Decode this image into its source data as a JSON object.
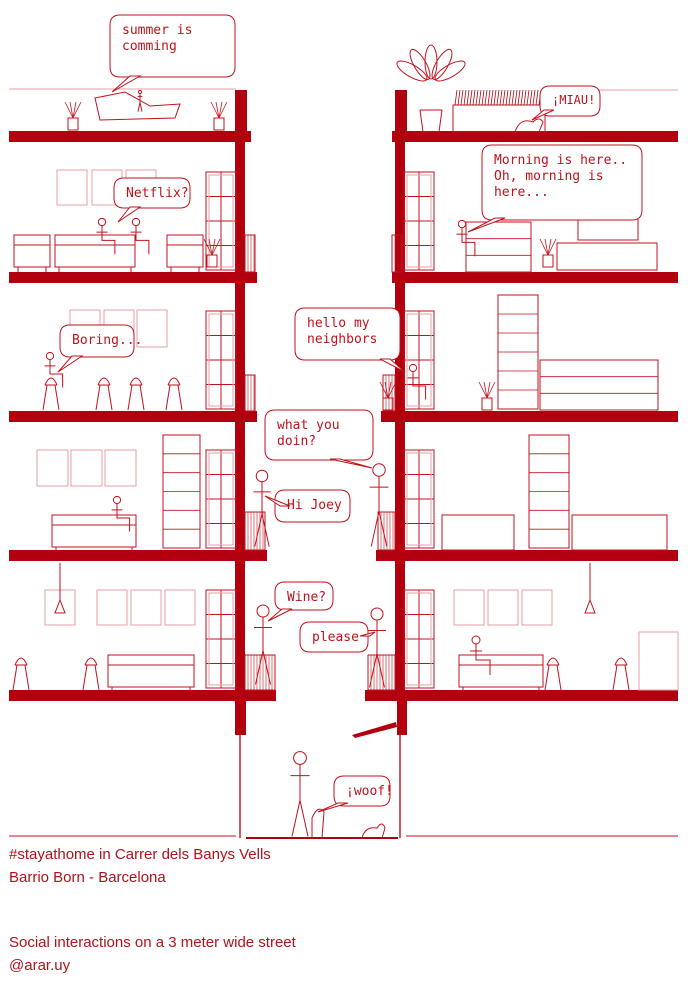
{
  "colors": {
    "accent": "#b3000f",
    "line": "#c0121c",
    "light_line": "#e6a1a6"
  },
  "bubbles": {
    "summer": "summer is\ncomming",
    "miau": "¡MIAU!",
    "netflix": "Netflix?",
    "morning": "Morning is here..\nOh, morning is\nhere...",
    "boring": "Boring...",
    "hello": "hello my\nneighbors",
    "what": "what you\ndoin?",
    "hijoey": "Hi Joey",
    "wine": "Wine?",
    "please": "please",
    "woof": "¡woof!"
  },
  "caption": {
    "line1": "#stayathome in Carrer dels Banys Vells",
    "line2": "Barrio Born - Barcelona",
    "line3": "Social interactions on a 3 meter wide street",
    "line4": "@arar.uy"
  }
}
